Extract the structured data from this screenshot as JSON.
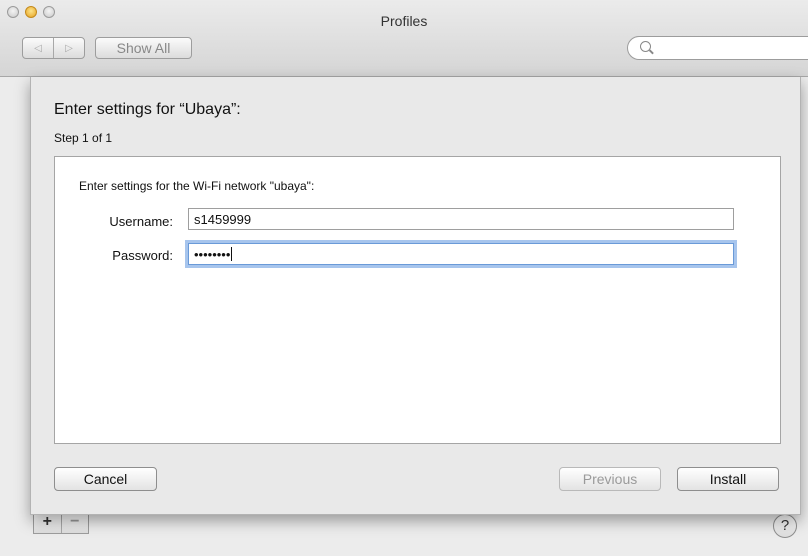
{
  "window": {
    "title": "Profiles",
    "show_all_label": "Show All",
    "back_glyph": "◁",
    "forward_glyph": "▷",
    "search_value": ""
  },
  "sheet": {
    "title": "Enter settings for “Ubaya”:",
    "step": "Step 1 of 1",
    "description": "Enter settings for the Wi-Fi network \"ubaya\":",
    "username_label": "Username:",
    "username_value": "s1459999",
    "password_label": "Password:",
    "password_value": "••••••••",
    "buttons": {
      "cancel": "Cancel",
      "previous": "Previous",
      "install": "Install"
    }
  },
  "pane": {
    "add_glyph": "+",
    "remove_glyph": "−",
    "help_glyph": "?"
  },
  "icons": [
    "close-icon",
    "minimize-icon",
    "zoom-icon",
    "back-arrow-icon",
    "forward-arrow-icon",
    "search-icon",
    "help-icon"
  ]
}
